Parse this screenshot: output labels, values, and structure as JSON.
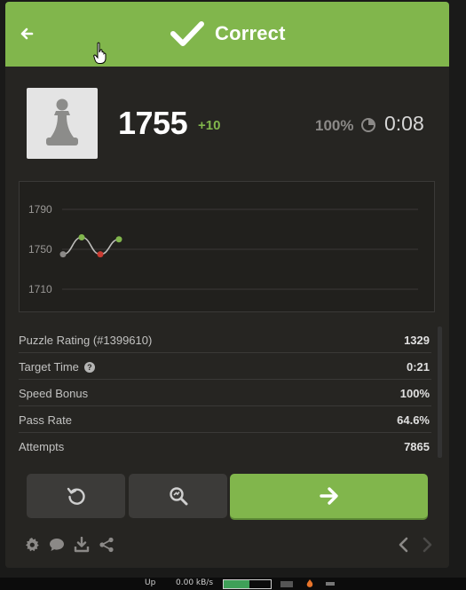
{
  "header": {
    "title": "Correct",
    "color": "#81b64c"
  },
  "player": {
    "rating": "1755",
    "delta": "+10",
    "accuracy": "100%",
    "time": "0:08"
  },
  "chart_data": {
    "type": "line",
    "x": [
      1,
      2,
      3,
      4
    ],
    "values": [
      1745,
      1762,
      1745,
      1760
    ],
    "point_colors": [
      "#8b8987",
      "#81b64c",
      "#c93b32",
      "#81b64c"
    ],
    "ylim": [
      1700,
      1800
    ],
    "yticks": [
      "1790",
      "1750",
      "1710"
    ],
    "ytick_values": [
      1790,
      1750,
      1710
    ],
    "grid": true
  },
  "stats": [
    {
      "label": "Puzzle Rating (#1399610)",
      "value": "1329",
      "help": false
    },
    {
      "label": "Target Time",
      "value": "0:21",
      "help": true
    },
    {
      "label": "Speed Bonus",
      "value": "100%",
      "help": false
    },
    {
      "label": "Pass Rate",
      "value": "64.6%",
      "help": false
    },
    {
      "label": "Attempts",
      "value": "7865",
      "help": false
    }
  ],
  "help_glyph": "?",
  "icons": {
    "back": "arrow-left-icon",
    "check": "checkmark-icon",
    "clock": "clock-icon",
    "retry": "retry-icon",
    "analyze": "magnify-icon",
    "next": "arrow-right-icon",
    "settings": "gear-icon",
    "chat": "chat-icon",
    "download": "download-icon",
    "share": "share-icon",
    "prev": "chevron-left-icon",
    "forward": "chevron-right-icon"
  },
  "taskbar": {
    "label": "Up",
    "speed": "0.00 kB/s",
    "meter": 0.55
  }
}
